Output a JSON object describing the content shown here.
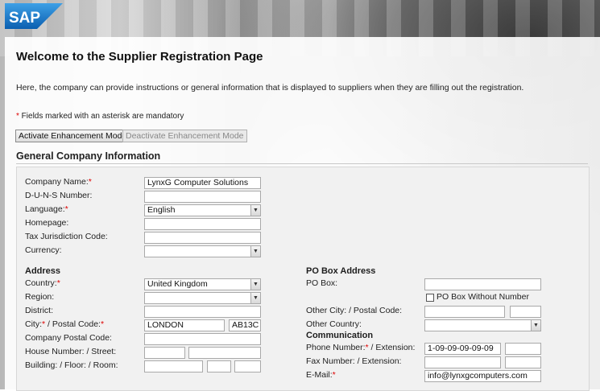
{
  "brand": {
    "logo_text": "SAP",
    "accent": "#1a75c8"
  },
  "page": {
    "title": "Welcome to the Supplier Registration Page",
    "intro": "Here, the company can provide instructions or general information that is displayed to suppliers when they are filling out the registration.",
    "mandatory_star": "*",
    "mandatory_note": " Fields marked with an asterisk are mandatory"
  },
  "buttons": {
    "activate": "Activate Enhancement Mode",
    "deactivate": "Deactivate Enhancement Mode"
  },
  "general": {
    "section_title": "General Company Information",
    "company_name": {
      "label": "Company Name:",
      "star": "*",
      "value": "LynxG Computer Solutions"
    },
    "duns": {
      "label": "D-U-N-S Number:",
      "value": ""
    },
    "language": {
      "label": "Language:",
      "star": "*",
      "value": "English"
    },
    "homepage": {
      "label": "Homepage:",
      "value": ""
    },
    "tax": {
      "label": "Tax Jurisdiction Code:",
      "value": ""
    },
    "currency": {
      "label": "Currency:",
      "value": ""
    }
  },
  "address": {
    "title": "Address",
    "country": {
      "label": "Country:",
      "star": "*",
      "value": "United Kingdom"
    },
    "region": {
      "label": "Region:",
      "value": ""
    },
    "district": {
      "label": "District:",
      "value": ""
    },
    "city": {
      "label_a": "City:",
      "star_a": "*",
      "label_b": " / Postal Code:",
      "star_b": "*",
      "city_value": "LONDON",
      "postal_value": "AB13C"
    },
    "company_postal": {
      "label": "Company Postal Code:",
      "value": ""
    },
    "house": {
      "label": "House Number: / Street:",
      "value": "",
      "street_value": ""
    },
    "building": {
      "label": "Building: / Floor: / Room:",
      "value": ""
    }
  },
  "po_box": {
    "title": "PO Box Address",
    "po_box": {
      "label": "PO Box:",
      "value": ""
    },
    "without_label": "PO Box Without Number",
    "without_checked": false,
    "other_city": {
      "label": "Other City: / Postal Code:",
      "value": ""
    },
    "other_country": {
      "label": "Other Country:",
      "value": ""
    }
  },
  "communication": {
    "title": "Communication",
    "phone": {
      "label": "Phone Number:",
      "star": "*",
      "label_b": " / Extension:",
      "value": "1-09-09-09-09-09",
      "ext": ""
    },
    "fax": {
      "label": "Fax Number: / Extension:",
      "value": "",
      "ext": ""
    },
    "email": {
      "label": "E-Mail:",
      "star": "*",
      "value": "info@lynxgcomputers.com"
    }
  }
}
